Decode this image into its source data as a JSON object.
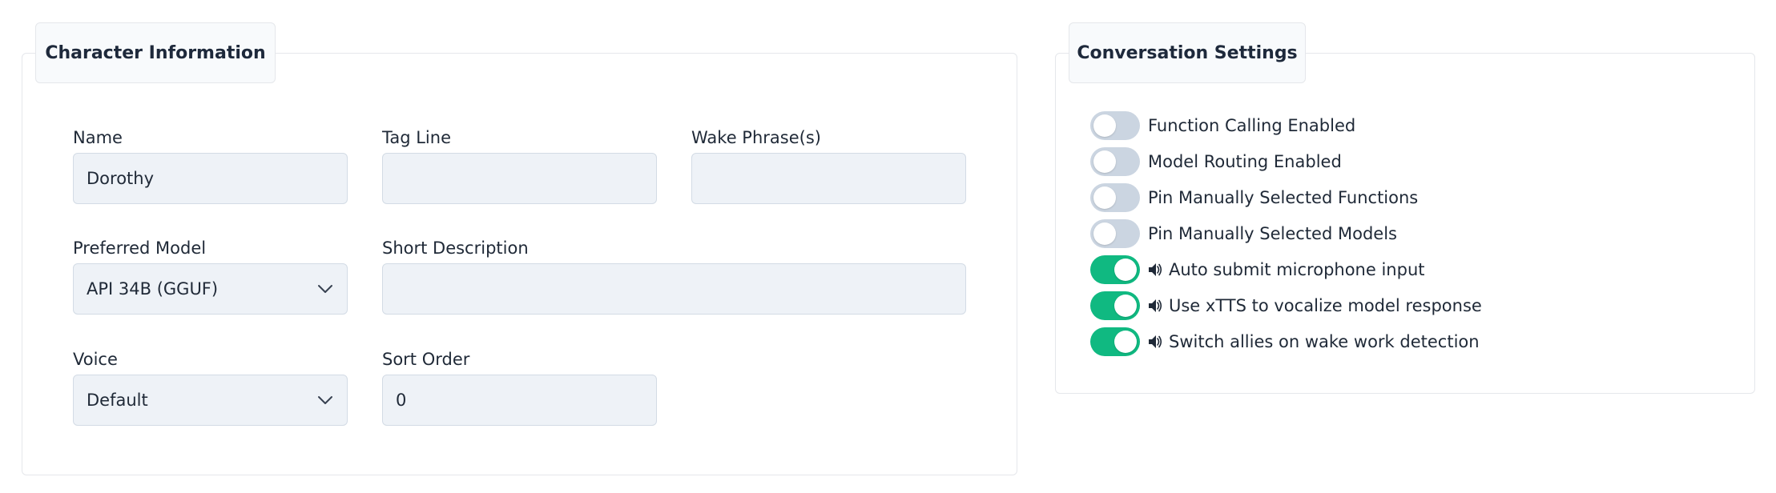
{
  "character_info": {
    "title": "Character Information",
    "fields": {
      "name": {
        "label": "Name",
        "value": "Dorothy"
      },
      "tag_line": {
        "label": "Tag Line",
        "value": ""
      },
      "wake_phrases": {
        "label": "Wake Phrase(s)",
        "value": ""
      },
      "preferred_model": {
        "label": "Preferred Model",
        "value": "API 34B (GGUF)"
      },
      "short_description": {
        "label": "Short Description",
        "value": ""
      },
      "voice": {
        "label": "Voice",
        "value": "Default"
      },
      "sort_order": {
        "label": "Sort Order",
        "value": "0"
      }
    }
  },
  "conversation_settings": {
    "title": "Conversation Settings",
    "toggles": [
      {
        "label": "Function Calling Enabled",
        "enabled": false,
        "icon": null
      },
      {
        "label": "Model Routing Enabled",
        "enabled": false,
        "icon": null
      },
      {
        "label": "Pin Manually Selected Functions",
        "enabled": false,
        "icon": null
      },
      {
        "label": "Pin Manually Selected Models",
        "enabled": false,
        "icon": null
      },
      {
        "label": "Auto submit microphone input",
        "enabled": true,
        "icon": "speaker-icon"
      },
      {
        "label": "Use xTTS to vocalize model response",
        "enabled": true,
        "icon": "speaker-icon"
      },
      {
        "label": "Switch allies on wake work detection",
        "enabled": true,
        "icon": "speaker-icon"
      }
    ]
  },
  "colors": {
    "toggle_on": "#10b981",
    "toggle_off": "#cbd5e1",
    "input_bg": "#eef2f7"
  }
}
